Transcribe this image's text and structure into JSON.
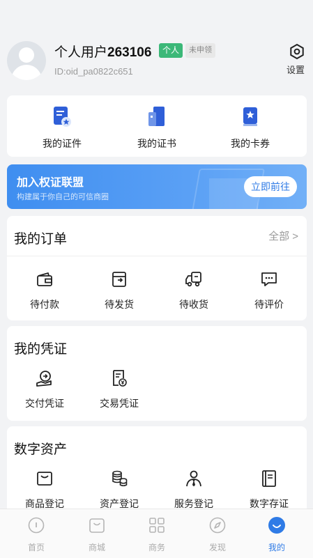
{
  "profile": {
    "name_prefix": "个人用户",
    "name_number": "263106",
    "badge_personal": "个人",
    "badge_status": "未申领",
    "id": "ID:oid_pa0822c651",
    "settings_label": "设置"
  },
  "certs": [
    {
      "label": "我的证件",
      "icon": "id-card-icon"
    },
    {
      "label": "我的证书",
      "icon": "certificate-icon"
    },
    {
      "label": "我的卡券",
      "icon": "coupon-icon"
    }
  ],
  "banner": {
    "title": "加入权证联盟",
    "subtitle": "构建属于你自己的可信商圈",
    "button": "立即前往"
  },
  "orders": {
    "title": "我的订单",
    "all": "全部 >",
    "items": [
      {
        "label": "待付款",
        "icon": "wallet-icon"
      },
      {
        "label": "待发货",
        "icon": "ship-box-icon"
      },
      {
        "label": "待收货",
        "icon": "truck-icon"
      },
      {
        "label": "待评价",
        "icon": "comment-icon"
      }
    ]
  },
  "vouchers": {
    "title": "我的凭证",
    "items": [
      {
        "label": "交付凭证",
        "icon": "hand-doc-icon"
      },
      {
        "label": "交易凭证",
        "icon": "receipt-yen-icon"
      }
    ]
  },
  "assets": {
    "title": "数字资产",
    "items": [
      {
        "label": "商品登记",
        "icon": "bag-icon"
      },
      {
        "label": "资产登记",
        "icon": "coins-icon"
      },
      {
        "label": "服务登记",
        "icon": "person-tie-icon"
      },
      {
        "label": "数字存证",
        "icon": "notebook-icon"
      }
    ]
  },
  "tabs": [
    {
      "label": "首页",
      "icon": "home-icon"
    },
    {
      "label": "商城",
      "icon": "shop-bag-icon"
    },
    {
      "label": "商务",
      "icon": "grid-icon"
    },
    {
      "label": "发现",
      "icon": "compass-icon"
    },
    {
      "label": "我的",
      "icon": "profile-smile-icon"
    }
  ],
  "colors": {
    "accent": "#2f7be6",
    "badge_green": "#3cb878",
    "background": "#f2f3f5"
  }
}
